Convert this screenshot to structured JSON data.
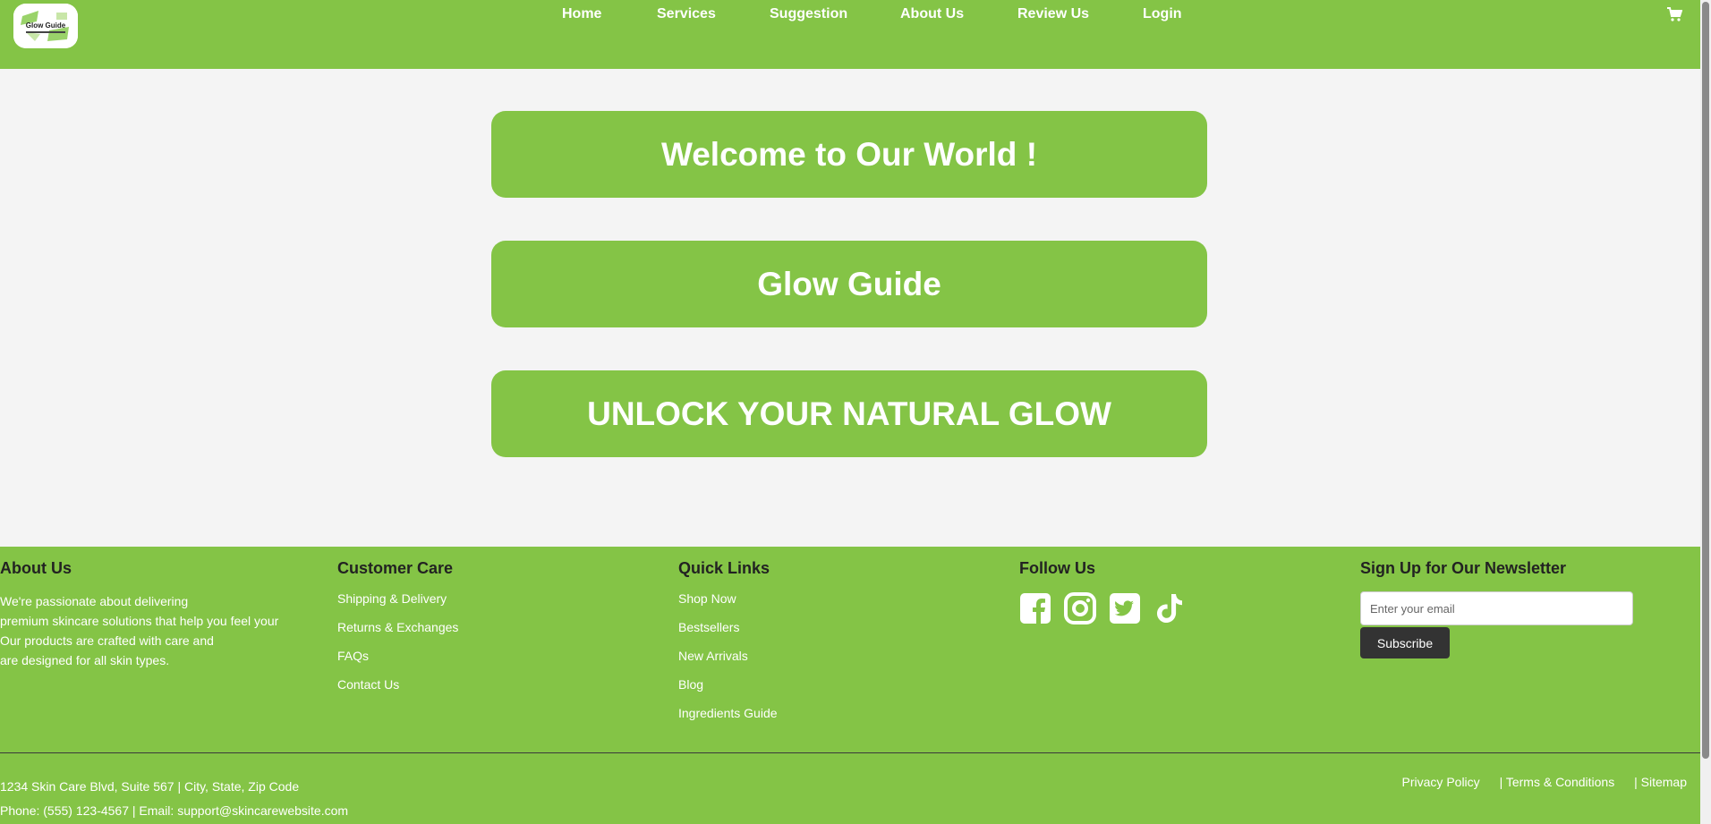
{
  "header": {
    "logo_text": "Glow Guide",
    "nav": [
      "Home",
      "Services",
      "Suggestion",
      "About Us",
      "Review Us",
      "Login"
    ],
    "cart_icon": "cart-icon"
  },
  "hero": {
    "welcome": "Welcome to Our World !",
    "brand": "Glow Guide",
    "tagline": "UNLOCK YOUR NATURAL GLOW"
  },
  "footer": {
    "about": {
      "title": "About Us",
      "lines": [
        "We're passionate about delivering",
        "premium skincare solutions that help you feel your",
        "Our products are crafted with care and",
        "are designed for all skin types."
      ]
    },
    "customer_care": {
      "title": "Customer Care",
      "links": [
        "Shipping & Delivery",
        "Returns & Exchanges",
        "FAQs",
        "Contact Us"
      ]
    },
    "quick_links": {
      "title": "Quick Links",
      "links": [
        "Shop Now",
        "Bestsellers",
        "New Arrivals",
        "Blog",
        "Ingredients Guide"
      ]
    },
    "follow": {
      "title": "Follow Us",
      "icons": [
        "facebook-icon",
        "instagram-icon",
        "twitter-icon",
        "tiktok-icon"
      ]
    },
    "newsletter": {
      "title": "Sign Up for Our Newsletter",
      "placeholder": "Enter your email",
      "button": "Subscribe"
    },
    "address": "1234 Skin Care Blvd, Suite 567 | City, State, Zip Code",
    "contact": "Phone: (555) 123-4567 | Email: support@skincarewebsite.com",
    "legal": [
      "Privacy Policy",
      "| Terms & Conditions",
      "| Sitemap"
    ]
  },
  "colors": {
    "primary": "#84c446",
    "background": "#f4f4f4",
    "dark": "#333333"
  }
}
